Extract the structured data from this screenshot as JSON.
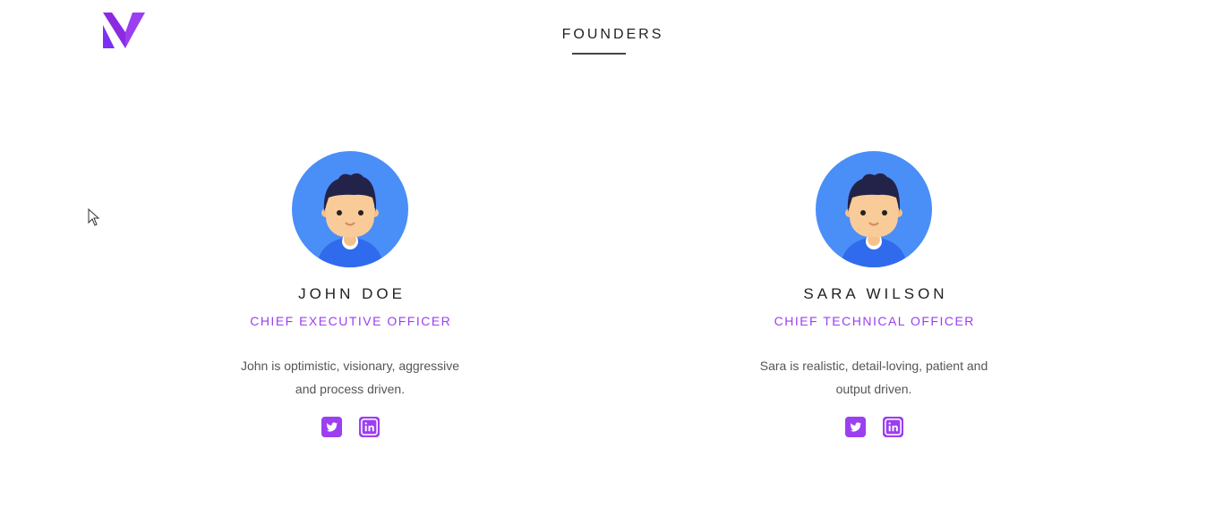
{
  "brand": {
    "logo_icon": "brand-logo-n",
    "accent_color": "#9b3ff0"
  },
  "section": {
    "title": "FOUNDERS"
  },
  "founders": [
    {
      "name": "JOHN DOE",
      "role": "CHIEF EXECUTIVE OFFICER",
      "bio": "John is optimistic, visionary, aggressive and process driven.",
      "avatar_icon": "avatar-illustration",
      "social": [
        "twitter-icon",
        "linkedin-icon"
      ]
    },
    {
      "name": "SARA WILSON",
      "role": "CHIEF TECHNICAL OFFICER",
      "bio": "Sara is realistic, detail-loving, patient and output driven.",
      "avatar_icon": "avatar-illustration",
      "social": [
        "twitter-icon",
        "linkedin-icon"
      ]
    }
  ],
  "colors": {
    "avatar_bg": "#4a8ef8",
    "social_bg": "#9b3ff0"
  }
}
